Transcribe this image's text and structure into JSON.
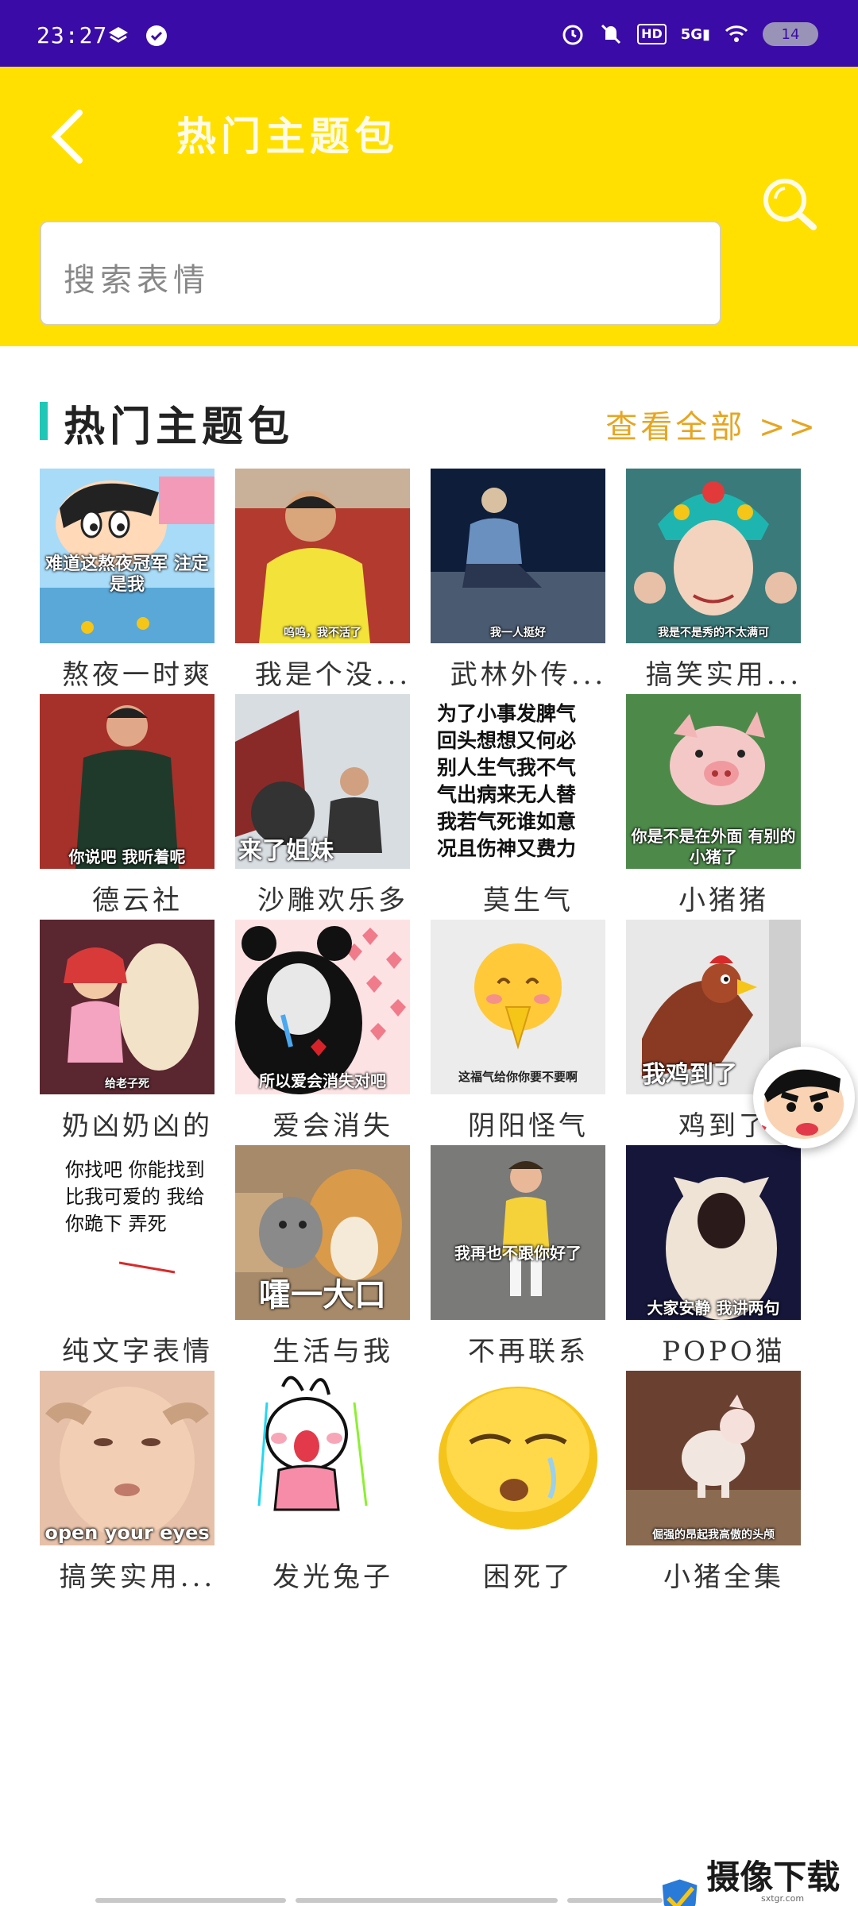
{
  "status_bar": {
    "time": "23:27",
    "battery": "14",
    "network": "5G",
    "hd": "HD",
    "icons": [
      "layers-icon",
      "check-circle-icon",
      "alarm-icon",
      "mute-icon",
      "hd-icon",
      "signal-icon",
      "wifi-icon",
      "battery-icon"
    ]
  },
  "header": {
    "title": "热门主题包",
    "search_placeholder": "搜索表情",
    "colors": {
      "background": "#ffe000",
      "status_bar": "#3a0ba6"
    }
  },
  "section": {
    "title": "热门主题包",
    "view_all": "查看全部 >>",
    "accent": "#1ec7b6",
    "link_color": "#e6a623"
  },
  "packs": [
    {
      "caption": "熬夜一时爽",
      "overlay": "难道这熬夜冠军 注定是我"
    },
    {
      "caption": "我是个没...",
      "overlay": "呜呜，我不活了"
    },
    {
      "caption": "武林外传...",
      "overlay": "我一人挺好"
    },
    {
      "caption": "搞笑实用...",
      "overlay": "我是不是秀的不太满可"
    },
    {
      "caption": "德云社",
      "overlay": "你说吧 我听着呢"
    },
    {
      "caption": "沙雕欢乐多",
      "overlay": "来了姐妹"
    },
    {
      "caption": "莫生气",
      "overlay": "为了小事发脾气 回头想想又何必 别人生气我不气 气出病来无人替 我若气死谁如意 况且伤神又费力"
    },
    {
      "caption": "小猪猪",
      "overlay": "你是不是在外面 有别的小猪了"
    },
    {
      "caption": "奶凶奶凶的",
      "overlay": "给老子死"
    },
    {
      "caption": "爱会消失",
      "overlay": "所以爱会消失对吧"
    },
    {
      "caption": "阴阳怪气",
      "overlay": "这福气给你你要不要啊"
    },
    {
      "caption": "鸡到了",
      "overlay": "我鸡到了"
    },
    {
      "caption": "纯文字表情",
      "overlay": "你找吧 你能找到 比我可爱的 我给你跪下 弄死"
    },
    {
      "caption": "生活与我",
      "overlay": "嚯一大口"
    },
    {
      "caption": "不再联系",
      "overlay": "我再也不跟你好了"
    },
    {
      "caption": "POPO猫",
      "overlay": "大家安静 我讲两句"
    },
    {
      "caption": "搞笑实用...",
      "overlay": "open your eyes"
    },
    {
      "caption": "发光兔子",
      "overlay": ""
    },
    {
      "caption": "困死了",
      "overlay": ""
    },
    {
      "caption": "小猪全集",
      "overlay": "倔强的昂起我高傲的头颅"
    }
  ],
  "watermark": {
    "text": "摄像下载站",
    "url": "sxtgr.com"
  }
}
